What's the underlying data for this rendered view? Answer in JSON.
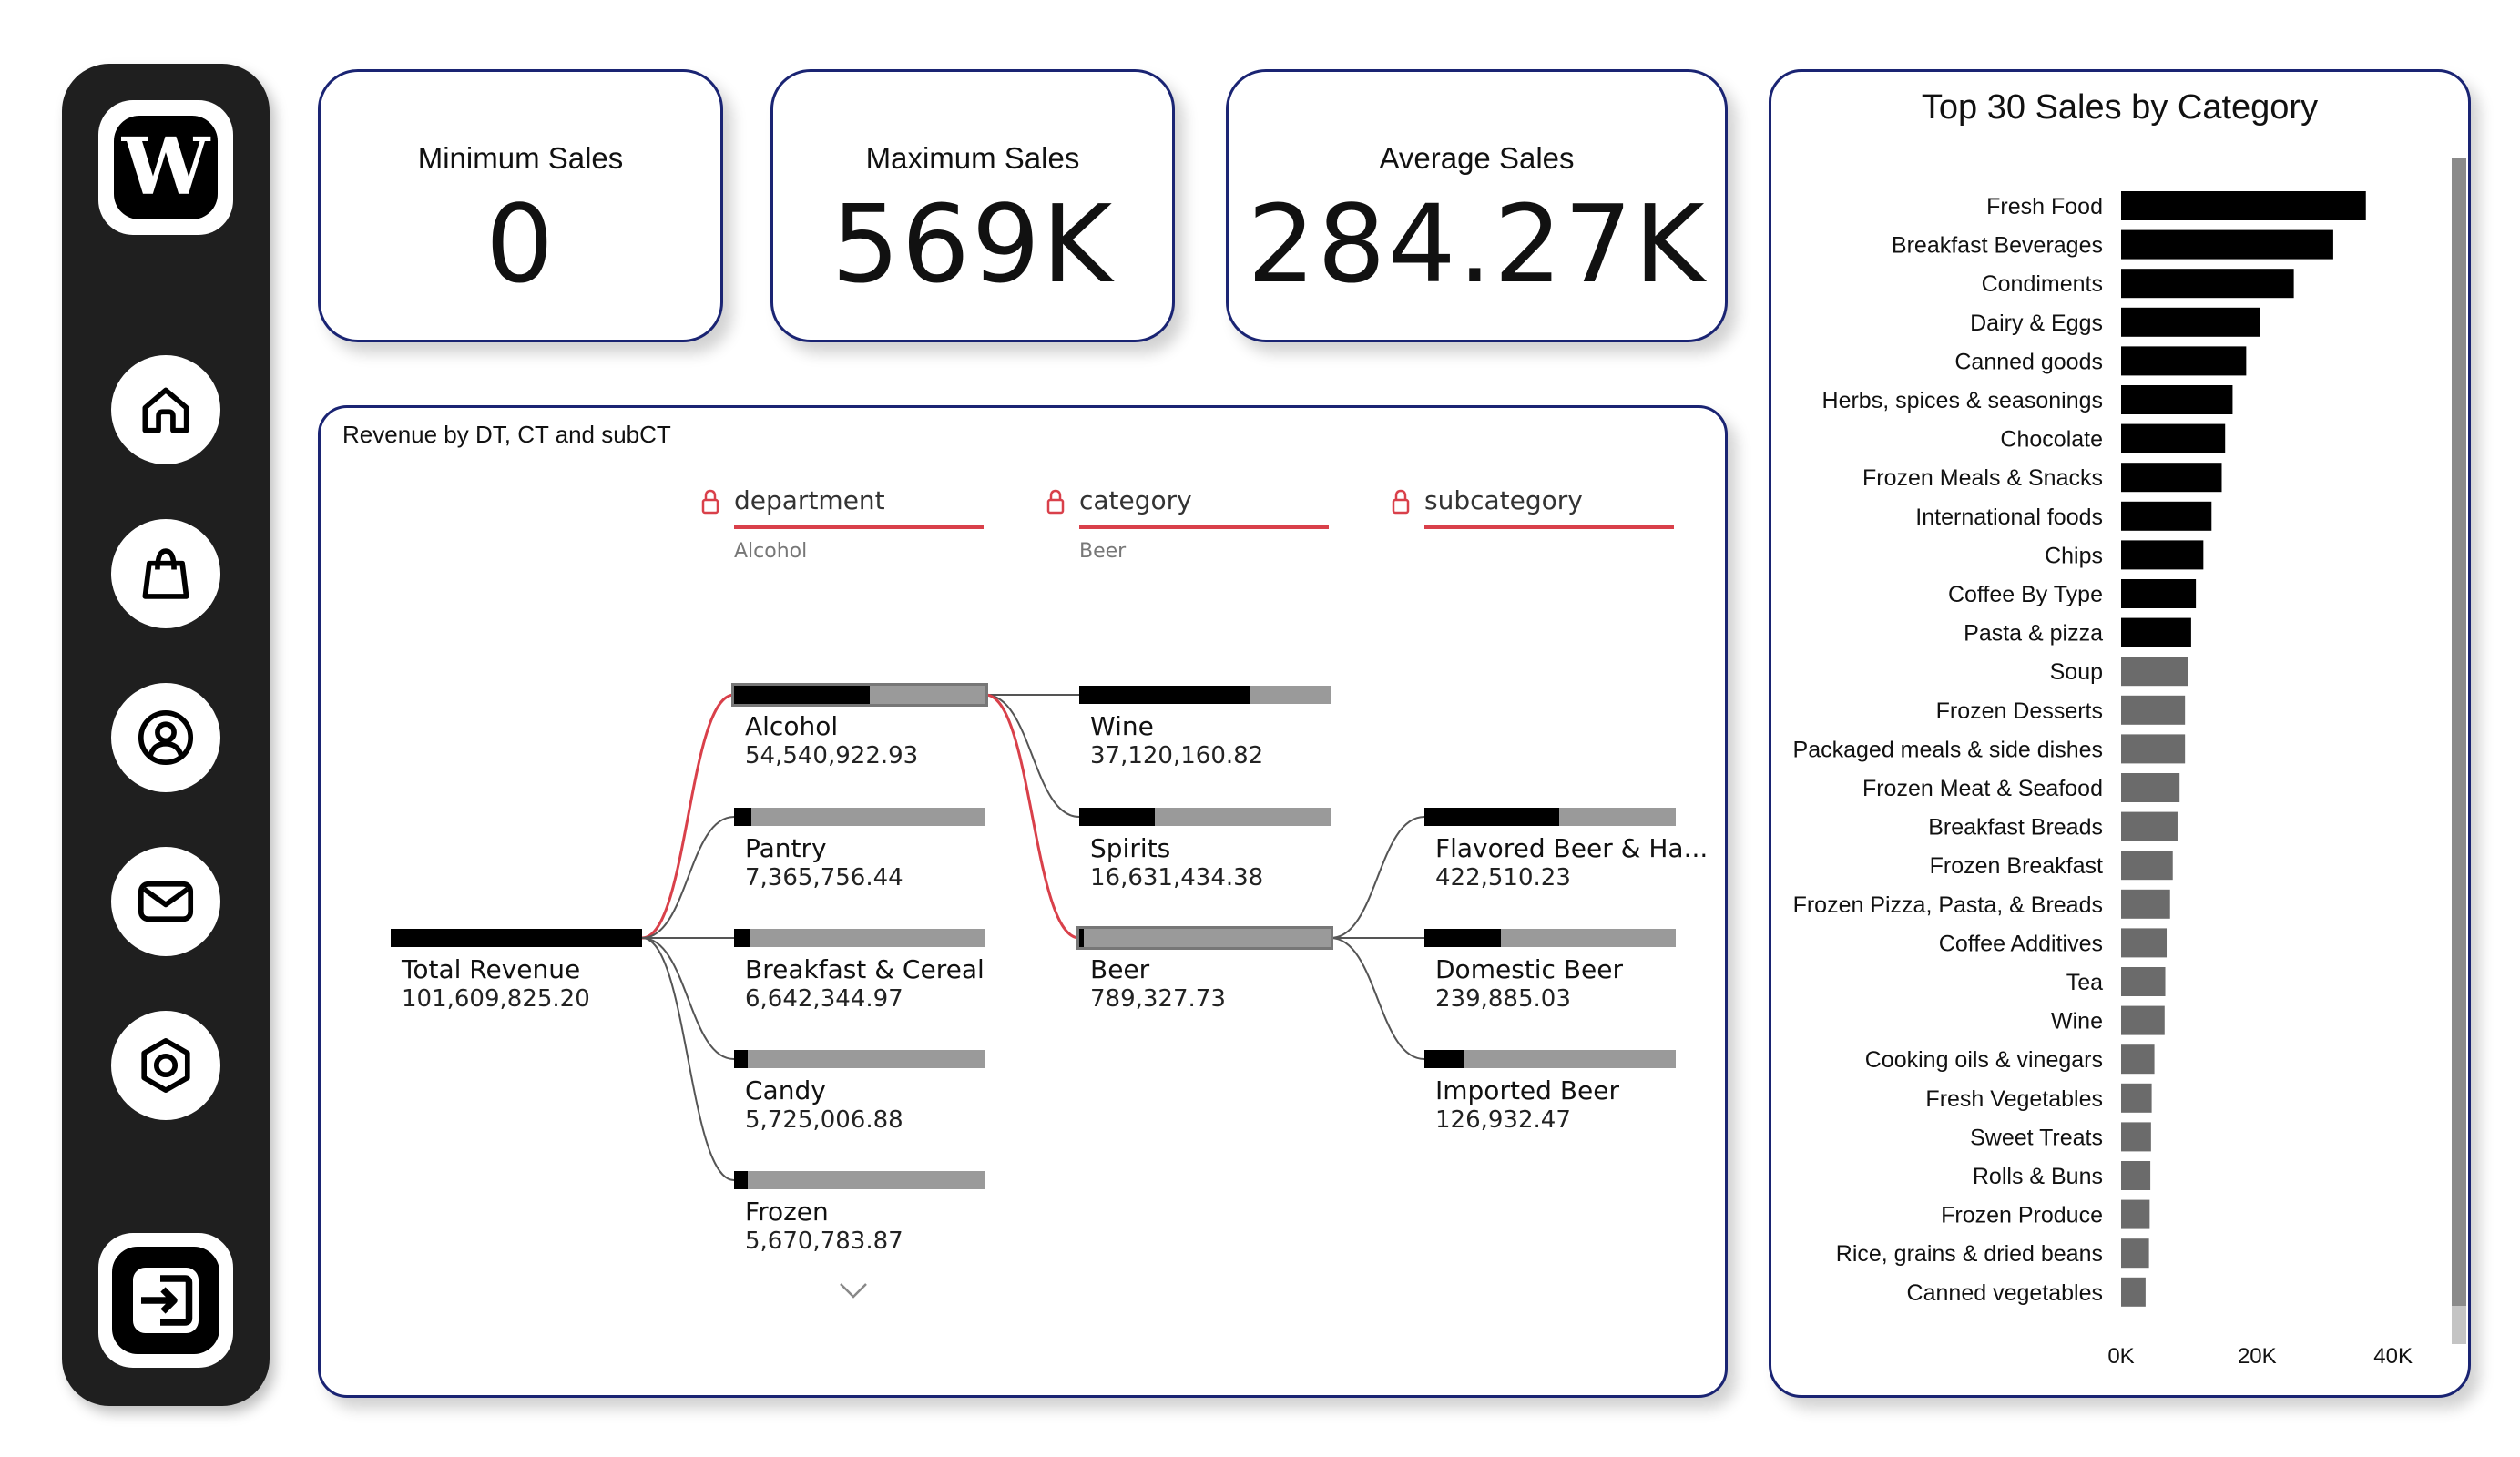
{
  "sidebar": {
    "logo_letter": "W",
    "nav": [
      {
        "icon": "home-icon"
      },
      {
        "icon": "shopping-bag-icon"
      },
      {
        "icon": "user-icon"
      },
      {
        "icon": "mail-icon"
      },
      {
        "icon": "settings-icon"
      }
    ],
    "exit_icon": "logout-icon"
  },
  "kpis": [
    {
      "title": "Minimum Sales",
      "value": "0"
    },
    {
      "title": "Maximum Sales",
      "value": "569K"
    },
    {
      "title": "Average Sales",
      "value": "284.27K"
    }
  ],
  "tree": {
    "title": "Revenue by DT, CT and subCT",
    "levels": [
      {
        "name": "department",
        "filter": "Alcohol"
      },
      {
        "name": "category",
        "filter": "Beer"
      },
      {
        "name": "subcategory",
        "filter": ""
      }
    ],
    "root": {
      "label": "Total Revenue",
      "value": "101,609,825.20",
      "fill": 1.0
    },
    "departments": [
      {
        "label": "Alcohol",
        "value": "54,540,922.93",
        "fill": 0.54,
        "highlight": true
      },
      {
        "label": "Pantry",
        "value": "7,365,756.44",
        "fill": 0.07
      },
      {
        "label": "Breakfast & Cereal",
        "value": "6,642,344.97",
        "fill": 0.065
      },
      {
        "label": "Candy",
        "value": "5,725,006.88",
        "fill": 0.056
      },
      {
        "label": "Frozen",
        "value": "5,670,783.87",
        "fill": 0.055
      }
    ],
    "categories": [
      {
        "label": "Wine",
        "value": "37,120,160.82",
        "fill": 0.68
      },
      {
        "label": "Spirits",
        "value": "16,631,434.38",
        "fill": 0.3
      },
      {
        "label": "Beer",
        "value": "789,327.73",
        "fill": 0.014,
        "highlight": true
      }
    ],
    "subcategories": [
      {
        "label": "Flavored Beer & Ha...",
        "value": "422,510.23",
        "fill": 0.535
      },
      {
        "label": "Domestic Beer",
        "value": "239,885.03",
        "fill": 0.304
      },
      {
        "label": "Imported Beer",
        "value": "126,932.47",
        "fill": 0.161
      }
    ],
    "more_icon": "chevron-down-icon",
    "lock_icon": "lock-icon",
    "colors": {
      "highlight": "#d9404a",
      "bar": "#000000",
      "track": "#9a9a9a"
    }
  },
  "chart_data": {
    "type": "bar",
    "orientation": "horizontal",
    "title": "Top 30 Sales by Category",
    "categories": [
      "Fresh Food",
      "Breakfast Beverages",
      "Condiments",
      "Dairy & Eggs",
      "Canned goods",
      "Herbs, spices & seasonings",
      "Chocolate",
      "Frozen Meals & Snacks",
      "International foods",
      "Chips",
      "Coffee By Type",
      "Pasta & pizza",
      "Soup",
      "Frozen Desserts",
      "Packaged meals & side dishes",
      "Frozen Meat & Seafood",
      "Breakfast Breads",
      "Frozen Breakfast",
      "Frozen Pizza, Pasta, & Breads",
      "Coffee Additives",
      "Tea",
      "Wine",
      "Cooking oils & vinegars",
      "Fresh Vegetables",
      "Sweet Treats",
      "Rolls & Buns",
      "Frozen Produce",
      "Rice, grains & dried beans",
      "Canned vegetables"
    ],
    "values": [
      36000,
      31200,
      25400,
      20400,
      18400,
      16400,
      15300,
      14800,
      13300,
      12100,
      11000,
      10300,
      9800,
      9400,
      9400,
      8600,
      8300,
      7600,
      7200,
      6700,
      6500,
      6400,
      4900,
      4500,
      4400,
      4300,
      4200,
      4100,
      3600
    ],
    "highlight_count": 12,
    "colors": {
      "highlight": "#000000",
      "normal": "#6b6b6b"
    },
    "xlim": [
      0,
      43000
    ],
    "xticks": [
      "0K",
      "20K",
      "40K"
    ],
    "xtick_values": [
      0,
      20000,
      40000
    ]
  }
}
